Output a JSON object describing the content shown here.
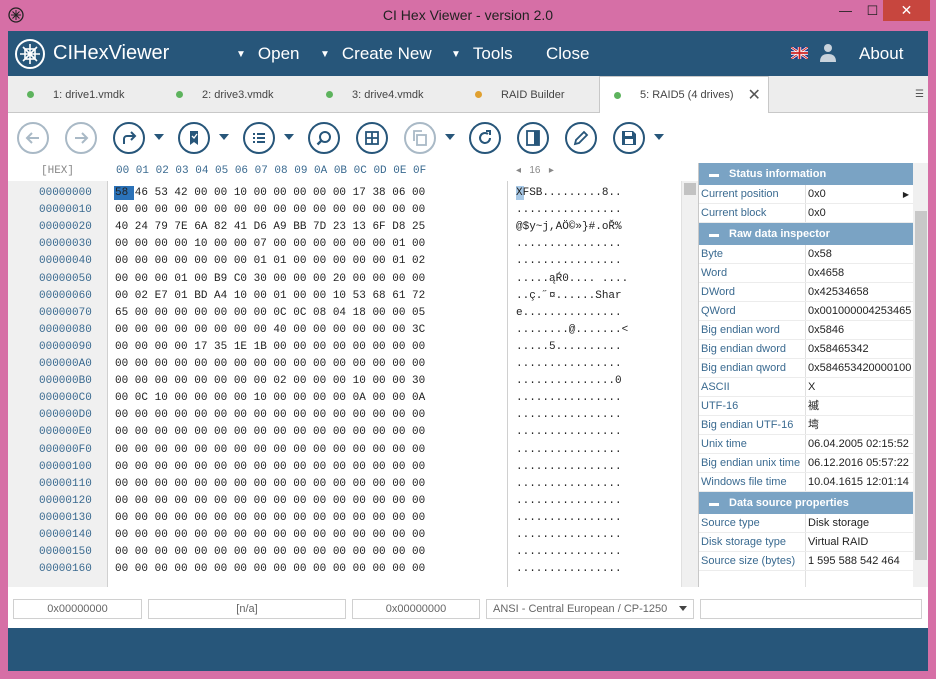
{
  "window": {
    "title": "CI Hex Viewer - version 2.0",
    "minimize": "—",
    "maximize": "☐",
    "close": "✕"
  },
  "menubar": {
    "brand": "CIHexViewer",
    "open": "Open",
    "create_new": "Create New",
    "tools": "Tools",
    "close": "Close",
    "about": "About"
  },
  "tabs": [
    {
      "label": "1: drive1.vmdk",
      "color": "#5db35d"
    },
    {
      "label": "2: drive3.vmdk",
      "color": "#5db35d"
    },
    {
      "label": "3: drive4.vmdk",
      "color": "#5db35d"
    },
    {
      "label": "RAID Builder",
      "color": "#e0a030"
    },
    {
      "label": "5: RAID5 (4 drives)",
      "color": "#5db35d"
    }
  ],
  "hex": {
    "tag": "[HEX]",
    "columns": "00 01 02 03 04 05 06 07 08 09 0A 0B 0C 0D 0E 0F",
    "page": "16",
    "offsets": [
      "00000000",
      "00000010",
      "00000020",
      "00000030",
      "00000040",
      "00000050",
      "00000060",
      "00000070",
      "00000080",
      "00000090",
      "000000A0",
      "000000B0",
      "000000C0",
      "000000D0",
      "000000E0",
      "000000F0",
      "00000100",
      "00000110",
      "00000120",
      "00000130",
      "00000140",
      "00000150",
      "00000160"
    ],
    "rows": [
      "58 46 53 42 00 00 10 00 00 00 00 00 17 38 06 00",
      "00 00 00 00 00 00 00 00 00 00 00 00 00 00 00 00",
      "40 24 79 7E 6A 82 41 D6 A9 BB 7D 23 13 6F D8 25",
      "00 00 00 00 10 00 00 07 00 00 00 00 00 00 01 00",
      "00 00 00 00 00 00 00 01 01 00 00 00 00 00 01 02",
      "00 00 00 01 00 B9 C0 30 00 00 00 20 00 00 00 00",
      "00 02 E7 01 BD A4 10 00 01 00 00 10 53 68 61 72",
      "65 00 00 00 00 00 00 00 0C 0C 08 04 18 00 00 05",
      "00 00 00 00 00 00 00 00 40 00 00 00 00 00 00 3C",
      "00 00 00 00 17 35 1E 1B 00 00 00 00 00 00 00 00",
      "00 00 00 00 00 00 00 00 00 00 00 00 00 00 00 00",
      "00 00 00 00 00 00 00 00 02 00 00 00 10 00 00 30",
      "00 0C 10 00 00 00 00 10 00 00 00 00 0A 00 00 0A",
      "00 00 00 00 00 00 00 00 00 00 00 00 00 00 00 00",
      "00 00 00 00 00 00 00 00 00 00 00 00 00 00 00 00",
      "00 00 00 00 00 00 00 00 00 00 00 00 00 00 00 00",
      "00 00 00 00 00 00 00 00 00 00 00 00 00 00 00 00",
      "00 00 00 00 00 00 00 00 00 00 00 00 00 00 00 00",
      "00 00 00 00 00 00 00 00 00 00 00 00 00 00 00 00",
      "00 00 00 00 00 00 00 00 00 00 00 00 00 00 00 00",
      "00 00 00 00 00 00 00 00 00 00 00 00 00 00 00 00",
      "00 00 00 00 00 00 00 00 00 00 00 00 00 00 00 00",
      "00 00 00 00 00 00 00 00 00 00 00 00 00 00 00 00"
    ],
    "ascii": [
      "XFSB.........8..",
      "................",
      "@$y~j,AÖ©»}#.oŘ%",
      "................",
      "................",
      ".....ąŔ0.... ....",
      "..ç.˝¤......Shar",
      "e...............",
      "........@.......<",
      ".....5..........",
      "................",
      "...............0",
      "................",
      "................",
      "................",
      "................",
      "................",
      "................",
      "................",
      "................",
      "................",
      "................",
      "................"
    ]
  },
  "side": {
    "status_title": "Status information",
    "status": [
      {
        "k": "Current position",
        "v": "0x0"
      },
      {
        "k": "Current block",
        "v": "0x0"
      }
    ],
    "raw_title": "Raw data inspector",
    "raw": [
      {
        "k": "Byte",
        "v": "0x58"
      },
      {
        "k": "Word",
        "v": "0x4658"
      },
      {
        "k": "DWord",
        "v": "0x42534658"
      },
      {
        "k": "QWord",
        "v": "0x001000004253465"
      },
      {
        "k": "Big endian word",
        "v": "0x5846"
      },
      {
        "k": "Big endian dword",
        "v": "0x58465342"
      },
      {
        "k": "Big endian qword",
        "v": "0x584653420000100"
      },
      {
        "k": "ASCII",
        "v": "X"
      },
      {
        "k": "UTF-16",
        "v": "䙘"
      },
      {
        "k": "Big endian UTF-16",
        "v": "塆"
      },
      {
        "k": "Unix time",
        "v": "06.04.2005 02:15:52"
      },
      {
        "k": "Big endian unix time",
        "v": "06.12.2016 05:57:22"
      },
      {
        "k": "Windows file time",
        "v": "10.04.1615 12:01:14"
      }
    ],
    "ds_title": "Data source properties",
    "ds": [
      {
        "k": "Source type",
        "v": "Disk storage"
      },
      {
        "k": "Disk storage type",
        "v": "Virtual RAID"
      },
      {
        "k": "Source size (bytes)",
        "v": "1 595 588 542 464"
      }
    ]
  },
  "statusbar": {
    "offset": "0x00000000",
    "selection": "[n/a]",
    "value": "0x00000000",
    "encoding": "ANSI - Central European / CP-1250",
    "extra": ""
  }
}
